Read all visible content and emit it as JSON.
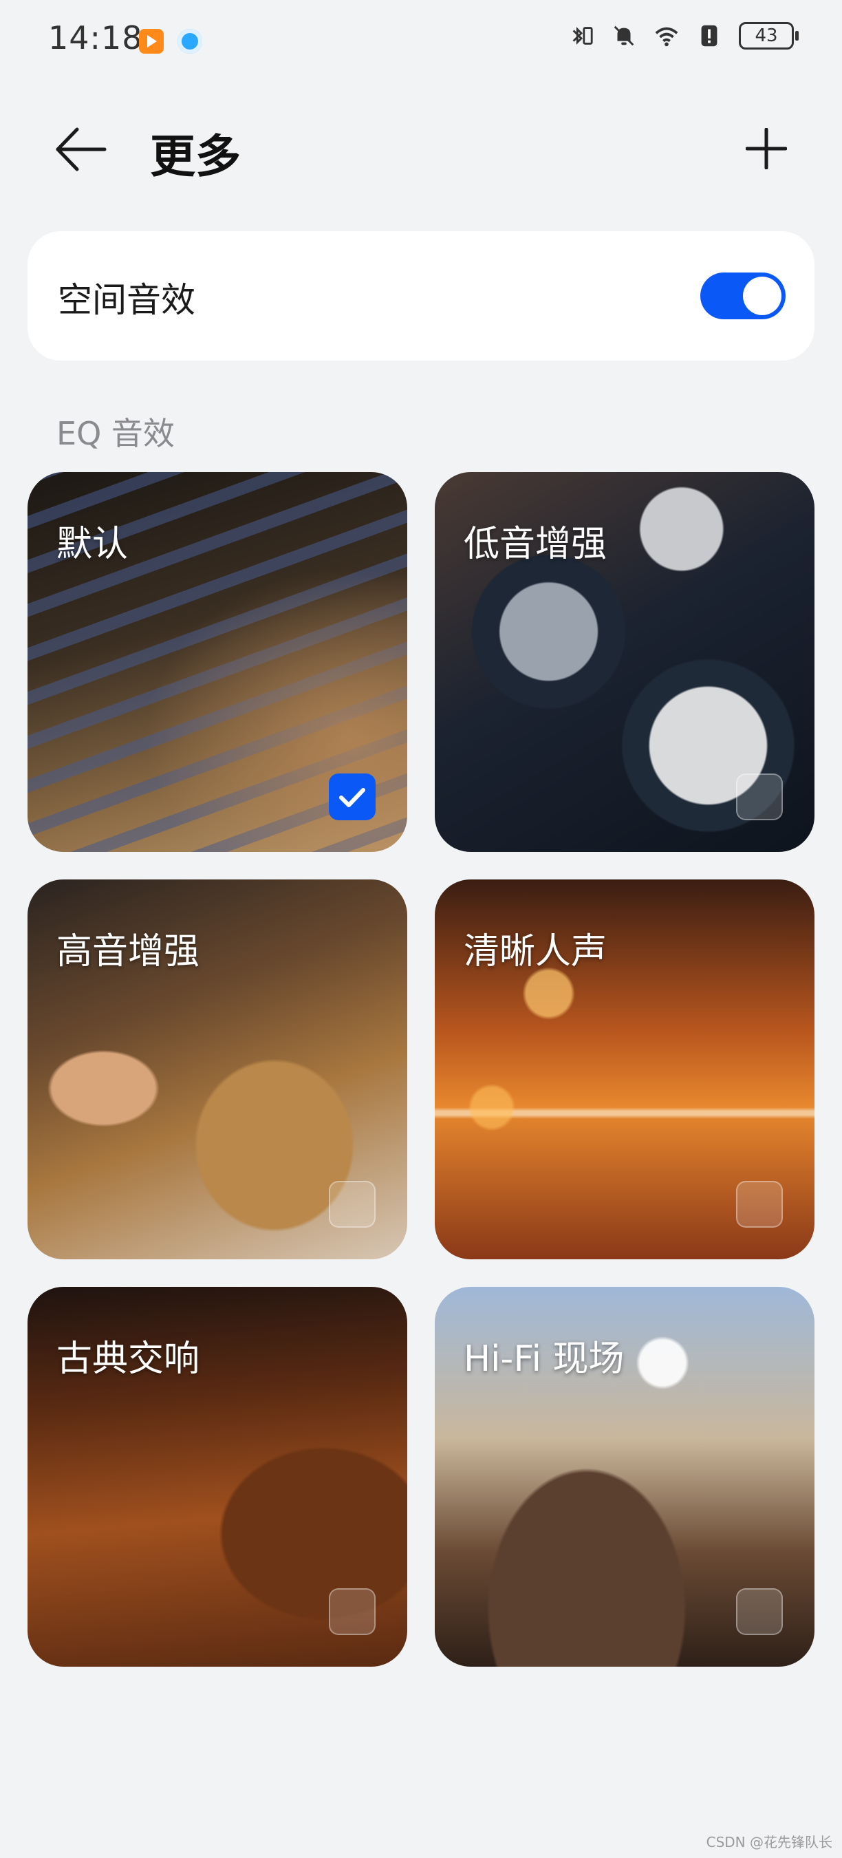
{
  "status_bar": {
    "time": "14:18",
    "battery": "43",
    "icons": [
      "app-notification-icon",
      "browser-icon",
      "bluetooth-vibrate-icon",
      "mute-icon",
      "wifi-icon",
      "alert-icon",
      "battery-icon"
    ]
  },
  "header": {
    "title": "更多",
    "back_icon": "back-arrow-icon",
    "add_icon": "plus-icon"
  },
  "spatial_audio": {
    "label": "空间音效",
    "enabled": true
  },
  "eq_section": {
    "label": "EQ 音效",
    "presets": [
      {
        "label": "默认",
        "selected": true
      },
      {
        "label": "低音增强",
        "selected": false
      },
      {
        "label": "高音增强",
        "selected": false
      },
      {
        "label": "清晰人声",
        "selected": false
      },
      {
        "label": "古典交响",
        "selected": false
      },
      {
        "label": "Hi-Fi 现场",
        "selected": false
      }
    ]
  },
  "watermark": "CSDN @花先锋队长",
  "colors": {
    "accent": "#0a59f7",
    "background": "#f1f3f5",
    "card": "#ffffff"
  }
}
